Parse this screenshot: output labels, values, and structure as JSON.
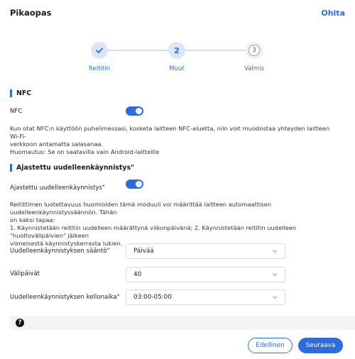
{
  "header": {
    "title": "Pikaopas",
    "skip": "Ohita"
  },
  "stepper": {
    "steps": [
      {
        "label": "Reititin",
        "state": "done"
      },
      {
        "label": "Muut",
        "number": "2",
        "state": "active"
      },
      {
        "label": "Valmis",
        "number": "3",
        "state": "pending"
      }
    ]
  },
  "nfc": {
    "section_title": "NFC",
    "toggle_label": "NFC",
    "enabled": true,
    "description_lines": [
      "Kun otat NFC:n käyttöön puhelimessasi, kosketa laitteen NFC-aluetta, niin voit muodostaa yhteyden laitteen Wi-Fi-",
      "verkkoon antamatta salasanaa.",
      "Huomautus: Se on saatavilla vain Android-laitteille"
    ]
  },
  "reboot": {
    "section_title": "Ajastettu uudelleenkäynnistys\"",
    "toggle_label": "Ajastettu uudelleenkäynnistys\"",
    "enabled": true,
    "description_lines": [
      "Reitittimen luotettavuus huomioiden tämä moduuli voi määrittää laitteen automaattisen uudelleenkäynnistyssäännön. Tähän",
      "on kaksi tapaa:",
      "1. Käynnistetään reititin uudelleen määrättynä viikonpäivänä; 2. Käynnistetään reititin uudelleen \"huoltovälipäivien\" jälkeen",
      "viimeisestä käynnistyskerrasta lukien."
    ],
    "fields": [
      {
        "label": "Uudelleenkäynnistyksen sääntö\"",
        "value": "Päivää"
      },
      {
        "label": "Välipäivät",
        "value": "40"
      },
      {
        "label": "Uudelleenkäynnistyksen kellonaika\"",
        "value": "03:00-05:00"
      }
    ]
  },
  "footer": {
    "help_symbol": "?",
    "prev": "Edellinen",
    "next": "Seuraava"
  },
  "colors": {
    "accent": "#2d6cdf"
  }
}
